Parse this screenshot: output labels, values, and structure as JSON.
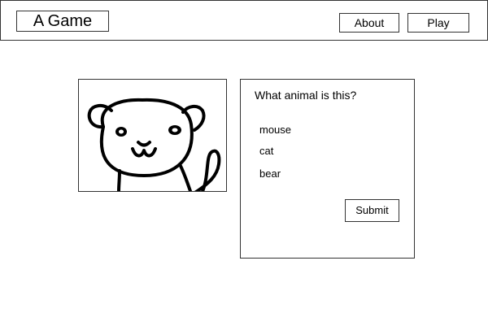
{
  "header": {
    "title": "A Game",
    "nav": {
      "about_label": "About",
      "play_label": "Play"
    }
  },
  "picture": {
    "subject_icon": "cat-icon"
  },
  "quiz": {
    "question": "What animal is this?",
    "options": [
      "mouse",
      "cat",
      "bear"
    ],
    "submit_label": "Submit"
  }
}
